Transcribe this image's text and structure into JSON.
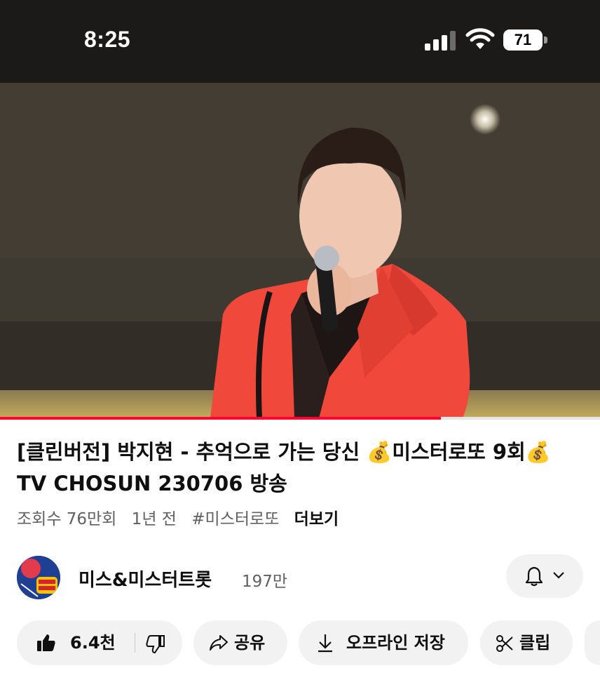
{
  "status_bar": {
    "time": "8:25",
    "battery": "71"
  },
  "video": {
    "progress_fraction": 0.735
  },
  "title": "[클린버전] 박지현 - 추억으로 가는 당신 💰미스터로또 9회💰 TV CHOSUN 230706 방송",
  "meta": {
    "views": "조회수 76만회",
    "age": "1년 전",
    "hashtag": "#미스터로또",
    "more": "더보기"
  },
  "channel": {
    "name": "미스&미스터트롯",
    "subscribers": "197만"
  },
  "actions": {
    "like_count": "6.4천",
    "share": "공유",
    "download": "오프라인 저장",
    "clip": "클립"
  },
  "icons": [
    "signal-icon",
    "wifi-icon",
    "battery-icon",
    "bell-icon",
    "chevron-down-icon",
    "like-icon",
    "dislike-icon",
    "share-icon",
    "download-icon",
    "scissors-icon"
  ]
}
